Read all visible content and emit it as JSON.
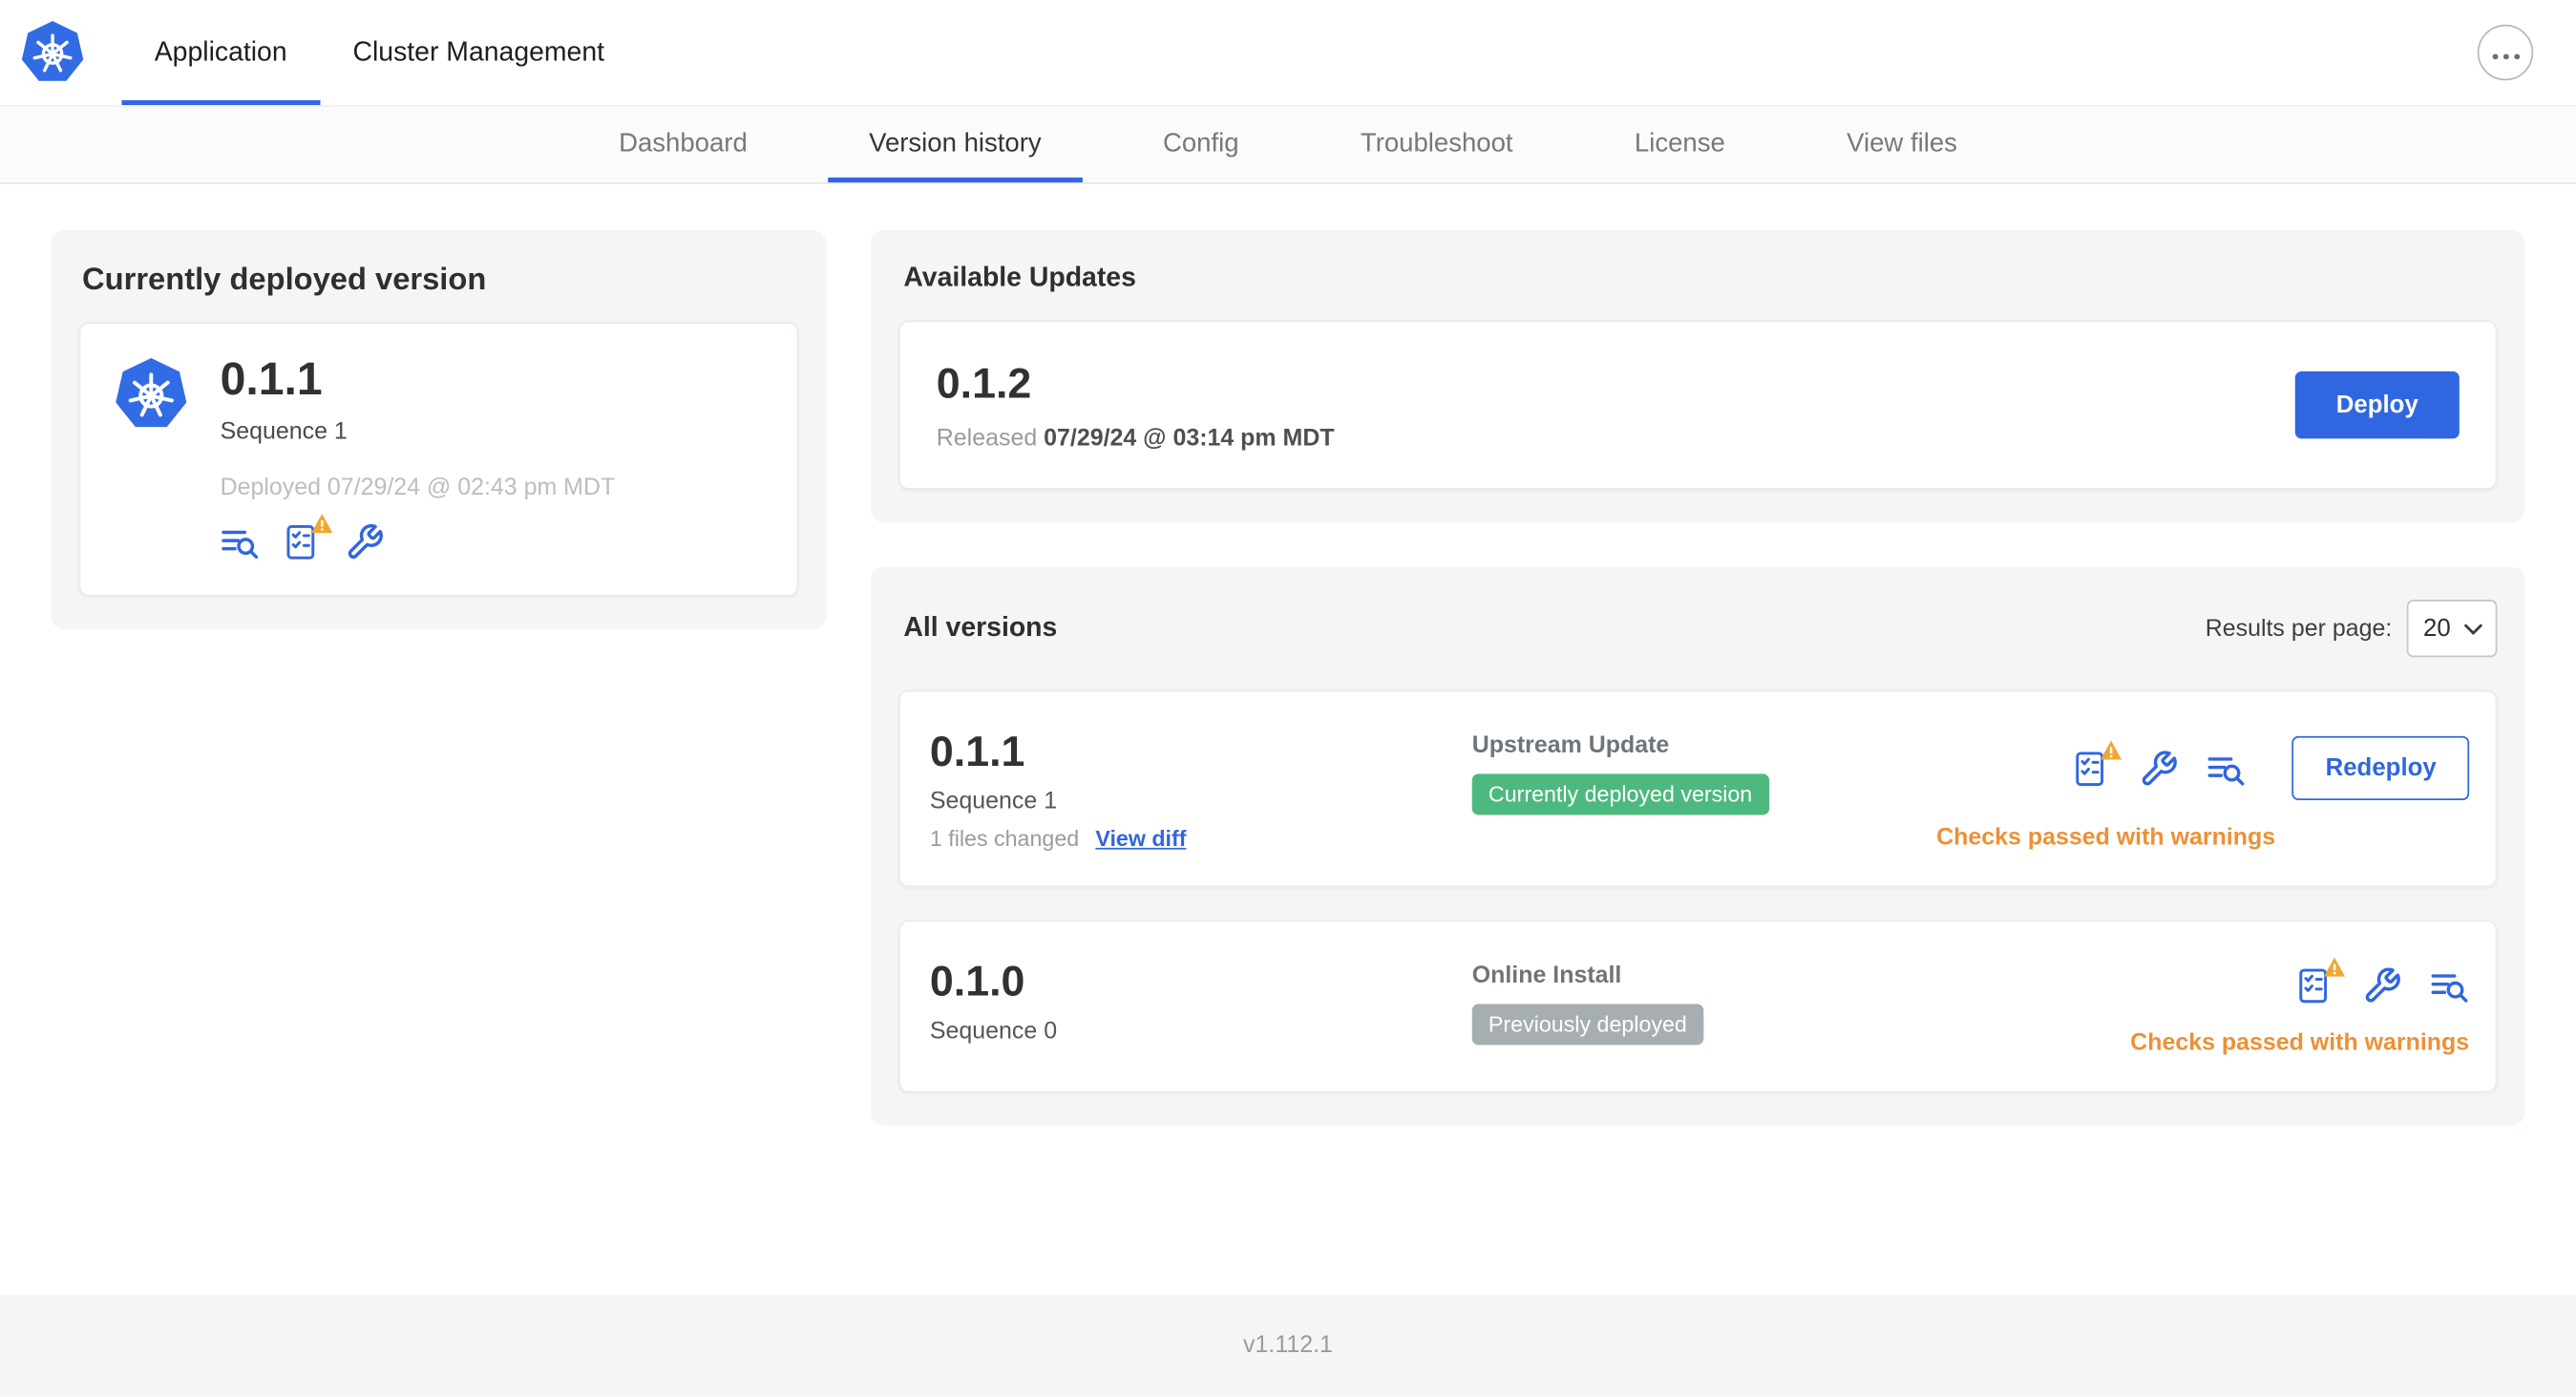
{
  "topnav": {
    "tabs": [
      {
        "label": "Application",
        "active": true
      },
      {
        "label": "Cluster Management",
        "active": false
      }
    ]
  },
  "subnav": {
    "tabs": [
      {
        "label": "Dashboard",
        "active": false
      },
      {
        "label": "Version history",
        "active": true
      },
      {
        "label": "Config",
        "active": false
      },
      {
        "label": "Troubleshoot",
        "active": false
      },
      {
        "label": "License",
        "active": false
      },
      {
        "label": "View files",
        "active": false
      }
    ]
  },
  "deployed_card": {
    "title": "Currently deployed version",
    "version": "0.1.1",
    "sequence": "Sequence 1",
    "deployed_at": "Deployed 07/29/24 @ 02:43 pm MDT"
  },
  "available_updates": {
    "title": "Available Updates",
    "version": "0.1.2",
    "released_prefix": "Released",
    "released_date": "07/29/24 @ 03:14 pm MDT",
    "deploy_label": "Deploy"
  },
  "all_versions": {
    "title": "All versions",
    "results_per_page_label": "Results per page:",
    "results_per_page_value": "20",
    "rows": [
      {
        "version": "0.1.1",
        "sequence": "Sequence 1",
        "files_changed": "1 files changed",
        "view_diff_label": "View diff",
        "source": "Upstream Update",
        "badge": "Currently deployed version",
        "badge_color": "green",
        "action_label": "Redeploy",
        "status": "Checks passed with warnings"
      },
      {
        "version": "0.1.0",
        "sequence": "Sequence 0",
        "source": "Online Install",
        "badge": "Previously deployed",
        "badge_color": "gray",
        "status": "Checks passed with warnings"
      }
    ]
  },
  "footer": {
    "version": "v1.112.1"
  },
  "icons": {
    "app_logo": "kubernetes-logo",
    "overflow_menu": "ellipsis",
    "view_logs": "lines-with-magnifier",
    "preflight_checks": "checklist-with-warning-triangle",
    "edit_config": "wrench",
    "select_chevron": "chevron-down"
  },
  "colors": {
    "accent_blue": "#3066e0",
    "kubernetes_blue": "#326ce5",
    "badge_green": "#4db97e",
    "badge_gray": "#a6aeb2",
    "warning_orange": "#ec9136",
    "warning_triangle_yellow": "#f0a732"
  }
}
